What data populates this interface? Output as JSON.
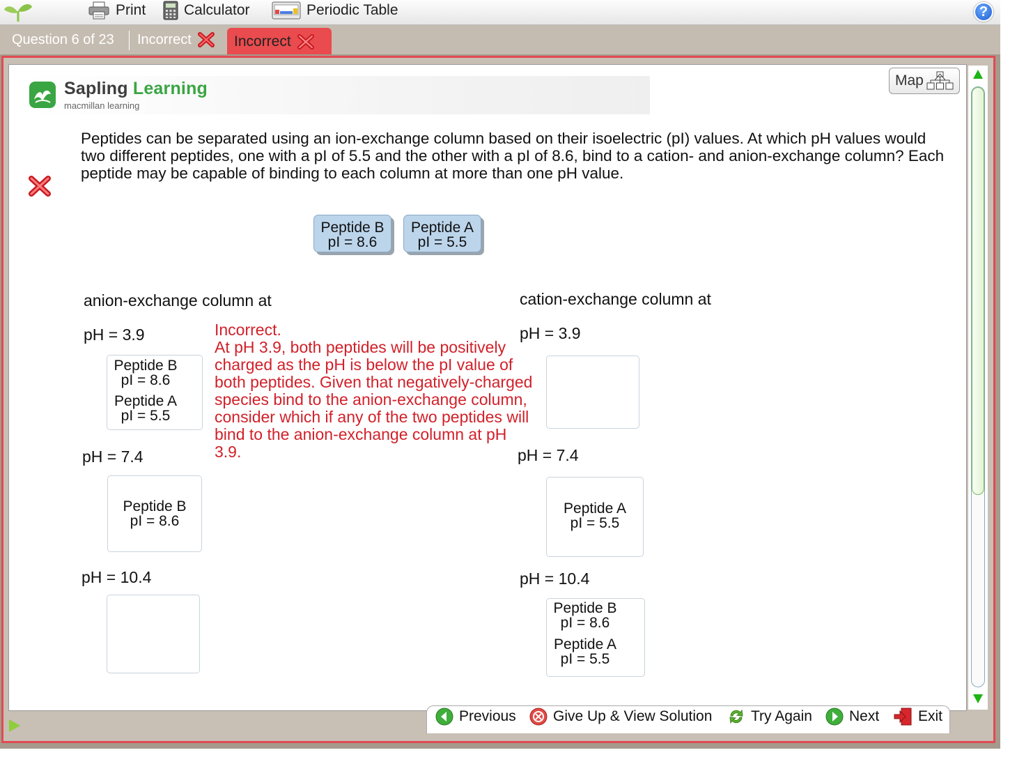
{
  "toolbar": {
    "print": "Print",
    "calculator": "Calculator",
    "periodic_table": "Periodic Table",
    "help": "?"
  },
  "tabs": {
    "question_counter": "Question 6 of 23",
    "status_previous": "Incorrect",
    "status_current": "Incorrect"
  },
  "brand": {
    "name_part1": "Sapling",
    "name_part2": "Learning",
    "subtitle": "macmillan learning"
  },
  "map_button": "Map",
  "question_text": "Peptides can be separated using an ion-exchange column based on their isoelectric (pI) values. At which pH values would two different peptides, one with a pI of 5.5 and the other with a pI of 8.6, bind to a cation- and anion-exchange column? Each peptide may be capable of binding to each column at more than one pH value.",
  "chips": {
    "peptide_b": {
      "name": "Peptide B",
      "pi": "pI = 8.6"
    },
    "peptide_a": {
      "name": "Peptide A",
      "pi": "pI = 5.5"
    }
  },
  "anion": {
    "heading": "anion-exchange column at",
    "ph1": "pH = 3.9",
    "ph2": "pH = 7.4",
    "ph3": "pH = 10.4",
    "box1": [
      {
        "name": "Peptide B",
        "pi": "pI = 8.6"
      },
      {
        "name": "Peptide A",
        "pi": "pI = 5.5"
      }
    ],
    "box2": [
      {
        "name": "Peptide B",
        "pi": "pI = 8.6"
      }
    ]
  },
  "cation": {
    "heading": "cation-exchange column at",
    "ph1": "pH = 3.9",
    "ph2": "pH = 7.4",
    "ph3": "pH = 10.4",
    "box2": [
      {
        "name": "Peptide A",
        "pi": "pI = 5.5"
      }
    ],
    "box3": [
      {
        "name": "Peptide B",
        "pi": "pI = 8.6"
      },
      {
        "name": "Peptide A",
        "pi": "pI = 5.5"
      }
    ]
  },
  "feedback": {
    "title": "Incorrect.",
    "body": "At pH 3.9, both peptides will be positively charged as the pH is below the pI value of both peptides. Given that negatively-charged species bind to the anion-exchange column, consider which if any of the two peptides will bind to the anion-exchange column at pH 3.9."
  },
  "nav": {
    "previous": "Previous",
    "give_up": "Give Up & View Solution",
    "try_again": "Try Again",
    "next": "Next",
    "exit": "Exit"
  },
  "colors": {
    "incorrect_red": "#d1212a",
    "tab_active": "#e94b4e",
    "brand_green": "#3aa543",
    "chip_blue": "#bcd5eb",
    "scroll_green": "#1db414"
  },
  "icons": [
    "sprout-logo-icon",
    "printer-icon",
    "calculator-icon",
    "periodic-table-icon",
    "help-icon",
    "x-mark-icon",
    "sapling-logo-icon",
    "sitemap-icon",
    "arrow-left-icon",
    "give-up-icon",
    "try-again-icon",
    "arrow-right-icon",
    "exit-icon"
  ]
}
